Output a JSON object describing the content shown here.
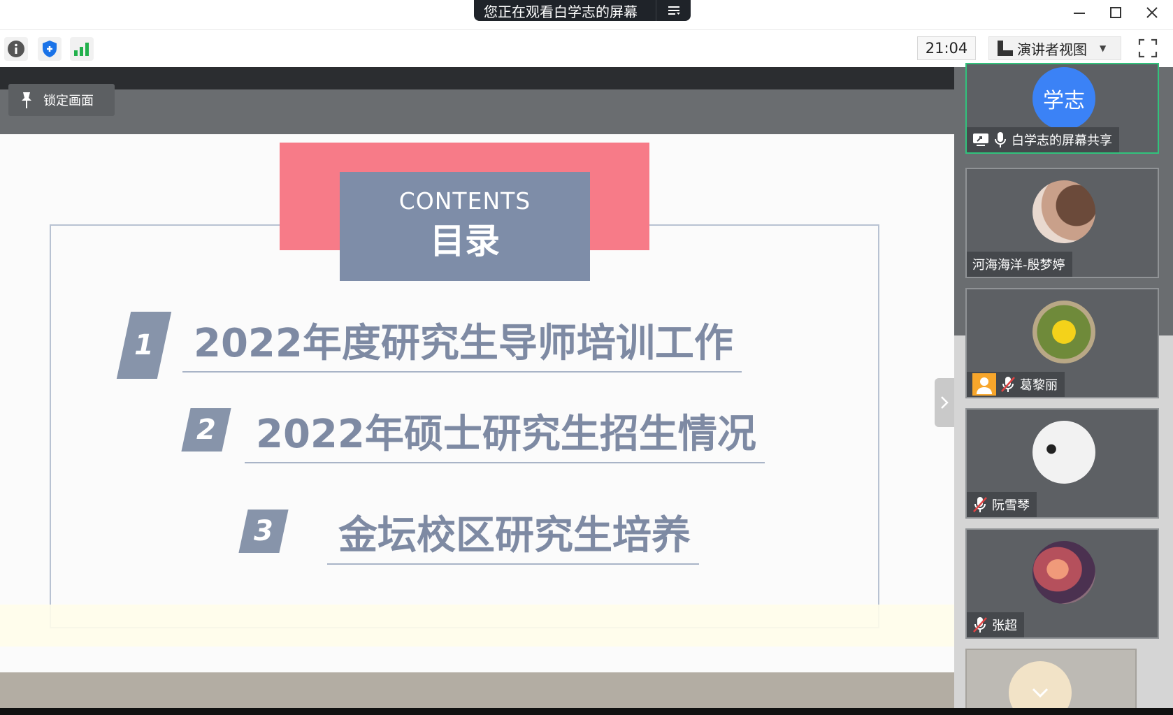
{
  "titlebar": {
    "share_banner": "您正在观看白学志的屏幕",
    "window_controls": [
      "minimize-icon",
      "maximize-icon",
      "close-icon"
    ]
  },
  "toolbar": {
    "icons": [
      "info-icon",
      "shield-icon",
      "signal-icon"
    ],
    "time": "21:04",
    "view_mode_label": "演讲者视图",
    "fullscreen_icon": "fullscreen-icon"
  },
  "stage": {
    "lock_label": "锁定画面",
    "slide": {
      "header_en": "CONTENTS",
      "header_zh": "目录",
      "items": [
        {
          "num": "1",
          "label": "2022年度研究生导师培训工作"
        },
        {
          "num": "2",
          "label": "2022年硕士研究生招生情况"
        },
        {
          "num": "3",
          "label": "金坛校区研究生培养"
        }
      ]
    }
  },
  "participants": [
    {
      "name": "白学志的屏幕共享",
      "avatar_text": "学志",
      "status": "sharing"
    },
    {
      "name": "河海海洋-殷梦婷",
      "status": ""
    },
    {
      "name": "葛黎丽",
      "status": "muted"
    },
    {
      "name": "阮雪琴",
      "status": "muted"
    },
    {
      "name": "张超",
      "status": "muted"
    }
  ],
  "colors": {
    "accent_green": "#31c27c",
    "slide_pink": "#f77b88",
    "slide_slate": "#7e8da8",
    "toolbar_blue": "#1a73e8",
    "signal_green": "#22b14c",
    "mute_red": "#e04343"
  }
}
